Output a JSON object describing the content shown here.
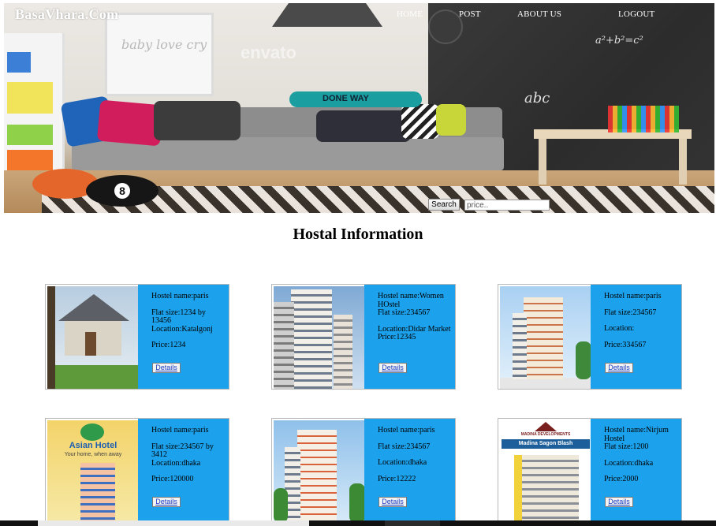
{
  "brand": "BasaVhara.Com",
  "nav": [
    {
      "label": "HOME"
    },
    {
      "label": "POST"
    },
    {
      "label": "ABOUT US"
    },
    {
      "label": "LOGOUT"
    }
  ],
  "search": {
    "button_label": "Search",
    "placeholder": "price.."
  },
  "section_title": "Hostal Information",
  "field_labels": {
    "name": "Hostel name:",
    "flat": "Flat size:",
    "location": "Location:",
    "price": "Price:",
    "details": "Details"
  },
  "hero_text": {
    "board": "DONE WAY",
    "ball": "8",
    "chalk1": "abc",
    "chalk2": "a²+b²=c²",
    "frame": "baby love cry",
    "watermark": "envato"
  },
  "hostels": [
    {
      "name": "paris",
      "flat": "1234 by 13456",
      "location": "Katalgonj",
      "price": "1234",
      "image": "house-icon"
    },
    {
      "name": "Women HOstel",
      "flat": "234567",
      "location": "Didar Market",
      "price": "12345",
      "image": "tower-icon"
    },
    {
      "name": "paris",
      "flat": "234567",
      "location": "",
      "price": "334567",
      "image": "tower-icon"
    },
    {
      "name": "paris",
      "flat": "234567 by 3412",
      "location": "dhaka",
      "price": "120000",
      "image": "hotel-poster-icon",
      "poster_title": "Asian Hotel",
      "poster_tag": "Your home, when away"
    },
    {
      "name": "paris",
      "flat": "234567",
      "location": "dhaka",
      "price": "12222",
      "image": "tower-icon"
    },
    {
      "name": "Nirjum Hostel",
      "flat": "1200",
      "location": "dhaka",
      "price": "2000",
      "image": "development-poster-icon",
      "poster_title": "Madina Sagon Blash",
      "poster_brand": "MADINA DEVELOPMENTS"
    }
  ],
  "colors": {
    "info_panel": "#1ca1ec",
    "nav_text": "#ffffff",
    "link": "#1d3fc4"
  }
}
